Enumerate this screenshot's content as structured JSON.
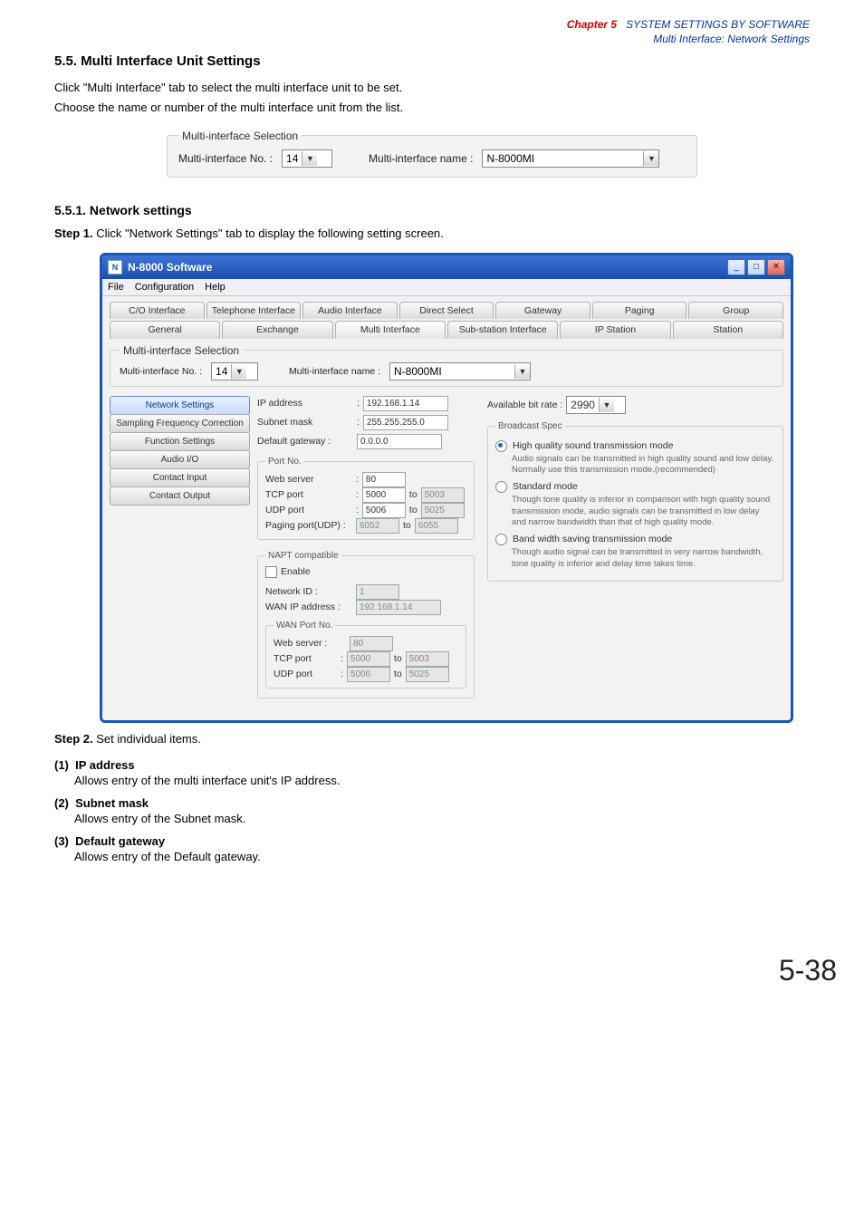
{
  "chapter": {
    "label": "Chapter 5",
    "title_line1": "SYSTEM SETTINGS BY SOFTWARE",
    "title_line2": "Multi Interface: Network Settings"
  },
  "section": {
    "number_title": "5.5. Multi Interface Unit Settings",
    "intro1": "Click \"Multi Interface\" tab to select the multi interface unit to be set.",
    "intro2": "Choose the name or number of the multi interface unit from the list."
  },
  "selection_box": {
    "legend": "Multi-interface Selection",
    "no_label": "Multi-interface No. :",
    "no_value": "14",
    "name_label": "Multi-interface name :",
    "name_value": "N-8000MI"
  },
  "subsection": {
    "title": "5.5.1. Network settings"
  },
  "step1": {
    "prefix": "Step 1.",
    "text": "Click \"Network Settings\" tab to display the following setting screen."
  },
  "app": {
    "title": "N-8000 Software",
    "menu": {
      "file": "File",
      "config": "Configuration",
      "help": "Help"
    },
    "tab_row1": {
      "co_interface": "C/O Interface",
      "telephone": "Telephone Interface",
      "audio": "Audio Interface",
      "direct": "Direct Select",
      "gateway": "Gateway",
      "paging": "Paging",
      "group": "Group"
    },
    "tab_row2": {
      "general": "General",
      "exchange": "Exchange",
      "multi": "Multi Interface",
      "substation": "Sub-station Interface",
      "ipstation": "IP Station",
      "station": "Station"
    },
    "inner_select": {
      "legend": "Multi-interface Selection",
      "no_label": "Multi-interface No. :",
      "no_value": "14",
      "name_label": "Multi-interface name :",
      "name_value": "N-8000MI"
    },
    "sidenav": [
      "Network Settings",
      "Sampling Frequency Correction",
      "Function Settings",
      "Audio I/O",
      "Contact Input",
      "Contact Output"
    ],
    "left_panel": {
      "ip_label": "IP address",
      "ip_value": "192.168.1.14",
      "subnet_label": "Subnet mask",
      "subnet_value": "255.255.255.0",
      "gateway_label": "Default gateway :",
      "gateway_value": "0.0.0.0",
      "portno_legend": "Port No.",
      "web_label": "Web server",
      "web_value": "80",
      "tcp_label": "TCP port",
      "tcp_from": "5000",
      "tcp_to": "5003",
      "udp_label": "UDP port",
      "udp_from": "5006",
      "udp_to": "5025",
      "paging_label": "Paging port(UDP) :",
      "paging_from": "6052",
      "paging_to": "6055",
      "napt_legend": "NAPT compatible",
      "enable_label": "Enable",
      "netid_label": "Network ID :",
      "netid_value": "1",
      "wanip_label": "WAN IP address :",
      "wanip_value": "192.168.1.14",
      "wanport_legend": "WAN Port No.",
      "wweb_label": "Web server :",
      "wweb_value": "80",
      "wtcp_label": "TCP port",
      "wtcp_from": "5000",
      "wtcp_to": "5003",
      "wudp_label": "UDP port",
      "wudp_from": "5006",
      "wudp_to": "5025",
      "to": "to",
      "colon": ":"
    },
    "right_panel": {
      "avail_label": "Available bit rate :",
      "avail_value": "2990",
      "broadcast_legend": "Broadcast Spec",
      "opt1_label": "High quality sound transmission mode",
      "opt1_desc": "Audio signals can be transmitted in high quality sound and low delay. Normally use this transmission mode.(recommended)",
      "opt2_label": "Standard mode",
      "opt2_desc": "Though tone quality is inferior in comparison with high quality sound transmission mode, audio signals can be transmitted in low delay and narrow bandwidth than that of high quality mode.",
      "opt3_label": "Band width saving transmission mode",
      "opt3_desc": "Though audio signal can be transmitted in very narrow bandwidth, tone quality is inferior and delay time takes time."
    }
  },
  "step2": {
    "prefix": "Step 2.",
    "text": "Set individual items."
  },
  "defs": [
    {
      "num": "(1)",
      "title": "IP address",
      "desc": "Allows entry of the multi interface unit's IP address."
    },
    {
      "num": "(2)",
      "title": "Subnet mask",
      "desc": "Allows entry of the Subnet mask."
    },
    {
      "num": "(3)",
      "title": "Default gateway",
      "desc": "Allows entry of the Default gateway."
    }
  ],
  "pagenum": "5-38"
}
